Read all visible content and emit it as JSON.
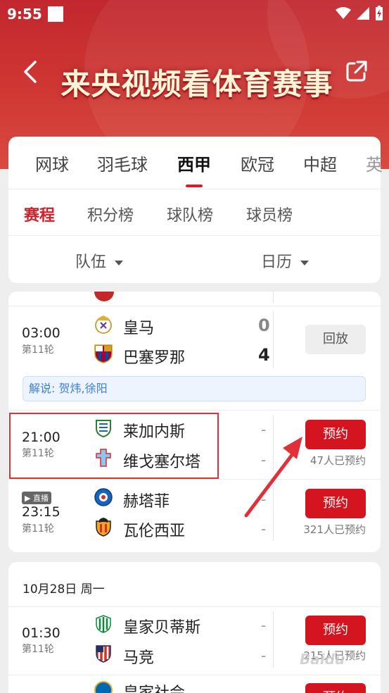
{
  "status_bar": {
    "time": "9:55"
  },
  "header": {
    "title": "来央视频看体育赛事"
  },
  "sport_tabs": [
    {
      "label": "网球"
    },
    {
      "label": "羽毛球"
    },
    {
      "label": "西甲"
    },
    {
      "label": "欧冠"
    },
    {
      "label": "中超"
    },
    {
      "label": "英"
    }
  ],
  "sub_tabs": [
    {
      "label": "赛程"
    },
    {
      "label": "积分榜"
    },
    {
      "label": "球队榜"
    },
    {
      "label": "球员榜"
    }
  ],
  "filters": {
    "team": "队伍",
    "calendar": "日历"
  },
  "matches": [
    {
      "time": "03:00",
      "round": "第11轮",
      "home": "皇马",
      "away": "巴塞罗那",
      "home_score": "0",
      "away_score": "4",
      "action": "回放",
      "commentary": "解说: 贺炜,徐阳"
    },
    {
      "time": "21:00",
      "round": "第11轮",
      "home": "莱加内斯",
      "away": "维戈塞尔塔",
      "home_score": "-",
      "away_score": "-",
      "action": "预约",
      "booked": "47人已预约"
    },
    {
      "live": "直播",
      "time": "23:15",
      "round": "第11轮",
      "home": "赫塔菲",
      "away": "瓦伦西亚",
      "home_score": "-",
      "away_score": "-",
      "action": "预约",
      "booked": "321人已预约"
    }
  ],
  "day2": {
    "date": "10月28日 周一",
    "matches": [
      {
        "time": "01:30",
        "round": "第11轮",
        "home": "皇家贝蒂斯",
        "away": "马竞",
        "home_score": "-",
        "away_score": "-",
        "action": "预约",
        "booked": "215人已预约"
      },
      {
        "home": "皇家社会",
        "action": "预约"
      }
    ]
  },
  "watermark": "Baidu",
  "colors": {
    "brand_red": "#d4141f",
    "header_red": "#c1272d",
    "link_blue": "#3d7fd1"
  }
}
